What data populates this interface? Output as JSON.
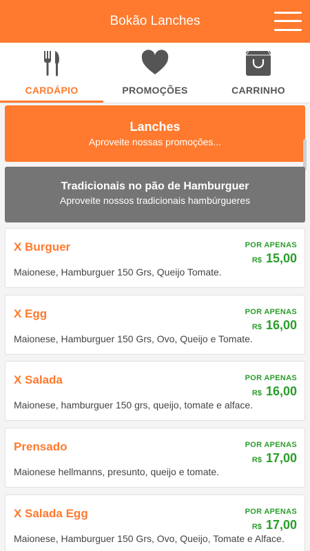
{
  "header": {
    "title": "Bokão Lanches",
    "menu_icon": "hamburger-menu-icon"
  },
  "tabs": [
    {
      "label": "CARDÁPIO",
      "icon": "fork-knife-icon",
      "active": true
    },
    {
      "label": "PROMOÇÕES",
      "icon": "heart-icon",
      "active": false
    },
    {
      "label": "CARRINHO",
      "icon": "shopping-bag-icon",
      "active": false
    }
  ],
  "banners": {
    "category": {
      "title": "Lanches",
      "subtitle": "Aproveite nossas promoções..."
    },
    "subcategory": {
      "title": "Tradicionais no pão de Hamburguer",
      "subtitle": "Aproveite nossos tradicionais hambúrgueres"
    }
  },
  "price_prefix": "POR APENAS",
  "currency": "R$",
  "items": [
    {
      "name": "X Burguer",
      "price": "15,00",
      "description": "Maionese, Hamburguer 150 Grs, Queijo Tomate."
    },
    {
      "name": "X Egg",
      "price": "16,00",
      "description": "Maionese, Hamburguer 150 Grs, Ovo, Queijo e Tomate."
    },
    {
      "name": "X Salada",
      "price": "16,00",
      "description": "Maionese, hamburguer 150 grs, queijo, tomate e alface."
    },
    {
      "name": "Prensado",
      "price": "17,00",
      "description": "Maionese hellmanns, presunto, queijo e tomate."
    },
    {
      "name": "X Salada Egg",
      "price": "17,00",
      "description": "Maionese, Hamburguer 150 Grs, Ovo, Queijo, Tomate e Alface."
    }
  ],
  "colors": {
    "accent": "#ff7a2e",
    "price": "#2a9d2a",
    "icon": "#555555",
    "gray_banner": "#757575"
  }
}
